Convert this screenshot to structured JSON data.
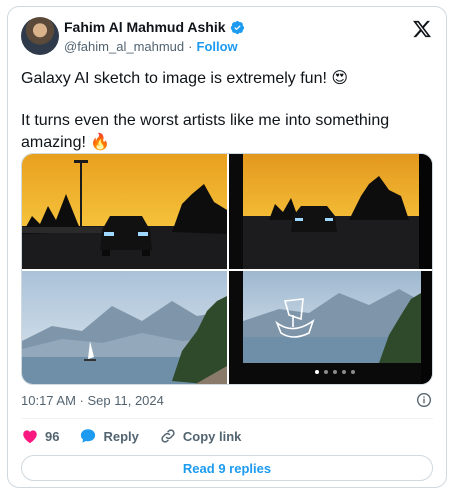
{
  "author": {
    "name": "Fahim Al Mahmud Ashik",
    "handle": "@fahim_al_mahmud",
    "separator": "·",
    "follow_label": "Follow"
  },
  "tweet": {
    "line1": "Galaxy AI sketch to image is extremely fun!",
    "line1_emoji": "😍",
    "line2": "It turns even the worst artists like me into something amazing!",
    "line2_emoji": "🔥"
  },
  "media": {
    "image_count": 4,
    "carousel_dots": 5,
    "active_dot": 1
  },
  "meta": {
    "timestamp": "10:17 AM · Sep 11, 2024"
  },
  "actions": {
    "likes_count": "96",
    "reply_label": "Reply",
    "copy_link_label": "Copy link"
  },
  "read_replies_label": "Read 9 replies",
  "colors": {
    "accent": "#1d9bf0",
    "like": "#f91880",
    "text": "#0f1419",
    "muted": "#536471",
    "border": "#cfd9de"
  },
  "icons": [
    "verified-badge-icon",
    "x-logo-icon",
    "info-icon",
    "heart-icon",
    "reply-bubble-icon",
    "link-icon"
  ]
}
